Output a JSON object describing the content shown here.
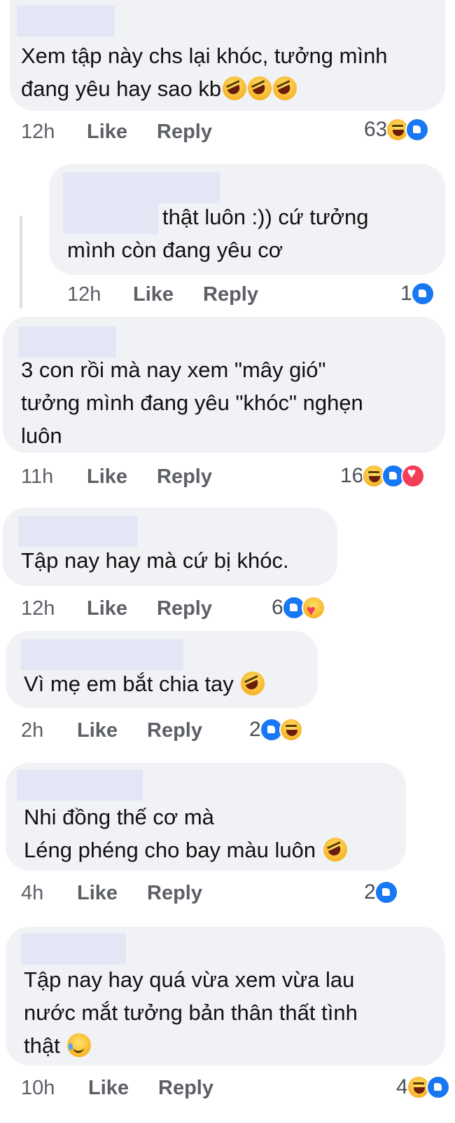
{
  "comments": [
    {
      "text": "Xem tập này chs lại khóc, tưởng mình\nđang yêu hay sao kb",
      "time": "12h",
      "like": "Like",
      "reply": "Reply",
      "count": "63",
      "reactions": [
        "haha",
        "like"
      ],
      "emoji": [
        "rofl",
        "rofl",
        "rofl"
      ]
    },
    {
      "text": "thật luôn :)) cứ tưởng\nmình còn đang yêu cơ",
      "time": "12h",
      "like": "Like",
      "reply": "Reply",
      "count": "1",
      "reactions": [
        "like"
      ]
    },
    {
      "text": "3 con rồi mà nay xem \"mây gió\"\ntưởng mình đang yêu \"khóc\" nghẹn\nluôn",
      "time": "11h",
      "like": "Like",
      "reply": "Reply",
      "count": "16",
      "reactions": [
        "haha",
        "like",
        "love"
      ]
    },
    {
      "text": "Tập nay hay mà cứ bị khóc.",
      "time": "12h",
      "like": "Like",
      "reply": "Reply",
      "count": "6",
      "reactions": [
        "like",
        "care"
      ]
    },
    {
      "text": "Vì mẹ em bắt chia tay",
      "time": "2h",
      "like": "Like",
      "reply": "Reply",
      "count": "2",
      "reactions": [
        "like",
        "haha"
      ],
      "emoji": [
        "rofl"
      ]
    },
    {
      "text": "Nhi đồng thế cơ mà\nLéng phéng cho bay màu luôn",
      "time": "4h",
      "like": "Like",
      "reply": "Reply",
      "count": "2",
      "reactions": [
        "like"
      ],
      "emoji": [
        "rofl"
      ]
    },
    {
      "text": "Tập nay hay quá vừa xem vừa lau\nnước mắt tưởng bản thân thất tình\nthật",
      "time": "10h",
      "like": "Like",
      "reply": "Reply",
      "count": "4",
      "reactions": [
        "haha",
        "like"
      ],
      "emoji": [
        "tear"
      ]
    }
  ]
}
